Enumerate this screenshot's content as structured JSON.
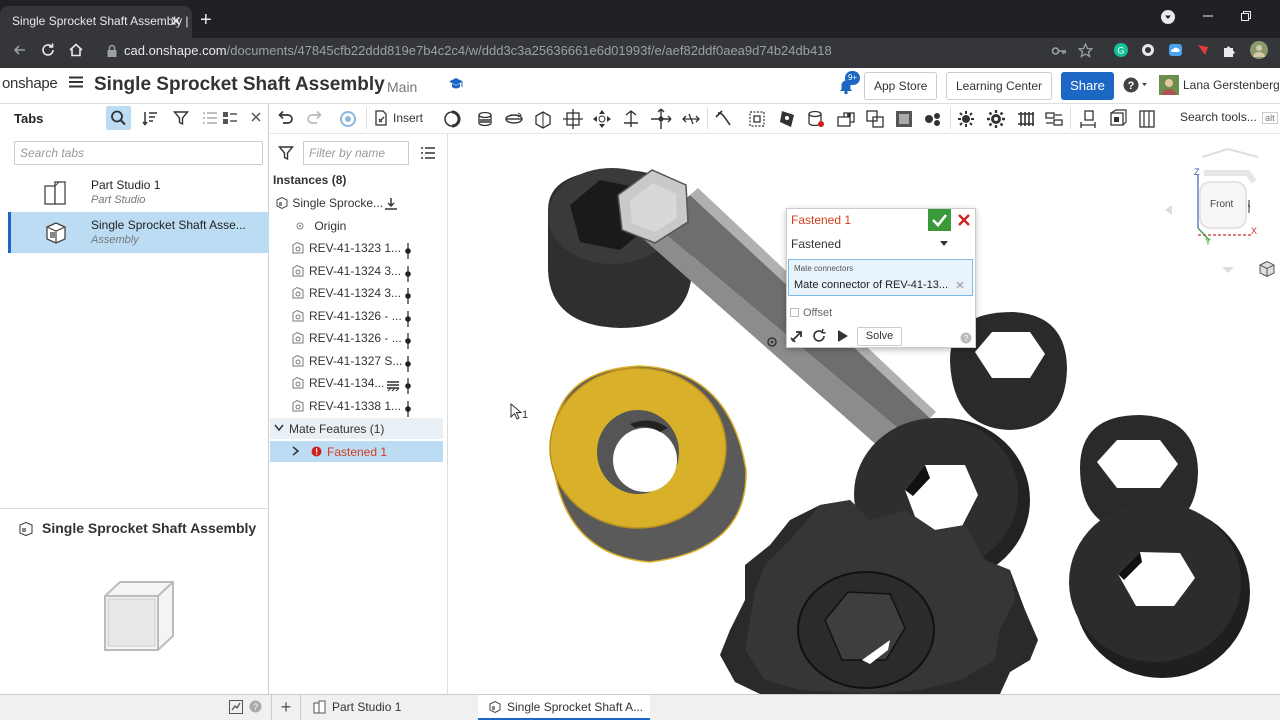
{
  "browser": {
    "tab_title": "Single Sprocket Shaft Assembly |",
    "tab_close": "✕",
    "new_tab": "+",
    "url_host": "cad.onshape.com",
    "url_path": "/documents/47845cfb22ddd819e7b4c2c4/w/ddd3c3a25636661e6d01993f/e/aef82ddf0aea9d74b24db418"
  },
  "header": {
    "logo": "onshape",
    "doc_title": "Single Sprocket Shaft Assembly",
    "branch": "Main",
    "notification_count": "9+",
    "app_store": "App Store",
    "learning_center": "Learning Center",
    "share": "Share",
    "user_name": "Lana Gerstenberg"
  },
  "tabs_panel": {
    "title": "Tabs",
    "search_placeholder": "Search tabs",
    "items": [
      {
        "name": "Part Studio 1",
        "type": "Part Studio"
      },
      {
        "name": "Single Sprocket Shaft Asse...",
        "type": "Assembly"
      }
    ],
    "preview_title": "Single Sprocket Shaft Assembly"
  },
  "instances_panel": {
    "filter_placeholder": "Filter by name",
    "header": "Instances (8)",
    "root": "Single Sprocke...",
    "origin": "Origin",
    "items": [
      "REV-41-1323 1...",
      "REV-41-1324 3...",
      "REV-41-1324 3...",
      "REV-41-1326 - ...",
      "REV-41-1326 - ...",
      "REV-41-1327 S...",
      "REV-41-134...",
      "REV-41-1338 1..."
    ],
    "mate_features": "Mate Features (1)",
    "mate_item": "Fastened 1"
  },
  "toolbar": {
    "insert": "Insert",
    "search_tools": "Search tools...",
    "search_shortcut": "alt"
  },
  "viewcube": {
    "face": "Front",
    "axis_z": "Z",
    "axis_x": "X",
    "axis_y": "Y"
  },
  "cursor_count": "1",
  "dialog": {
    "title": "Fastened 1",
    "type": "Fastened",
    "connectors_label": "Mate connectors",
    "connectors_value": "Mate connector of REV-41-13...",
    "offset": "Offset",
    "solve": "Solve"
  },
  "bottom_tabs": {
    "add": "+",
    "part_studio": "Part Studio 1",
    "assembly": "Single Sprocket Shaft A..."
  },
  "colors": {
    "accent": "#1c66c4",
    "selected_tab": "#bcdcf4",
    "highlight_part": "#d9b02a",
    "error": "#d04020",
    "ok": "#3a9a3a"
  }
}
